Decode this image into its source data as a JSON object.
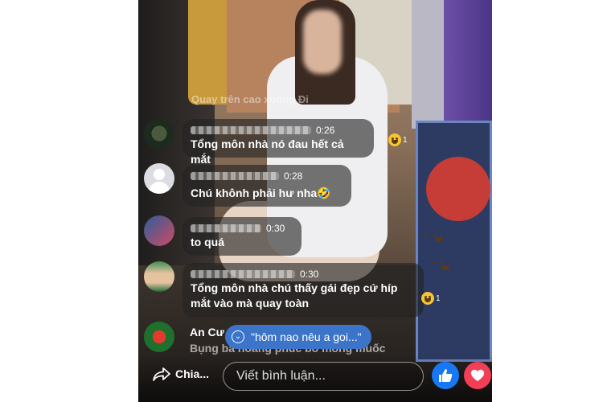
{
  "stream": {
    "dim_comment": "Quay trên cao xuống Đi"
  },
  "comments": [
    {
      "time": "0:26",
      "text": "Tổng môn nhà nó đau hết cả mắt",
      "reaction_count": "1"
    },
    {
      "time": "0:28",
      "text": "Chú khônh phải hư nha🤣"
    },
    {
      "time": "0:30",
      "text": "to quá"
    },
    {
      "time": "0:30",
      "text_line1": "Tổng môn nhà chú thấy gái đẹp cứ híp",
      "text_line2": "mắt vào mà quay toàn",
      "reaction_count": "1"
    },
    {
      "name": "An Cư",
      "text": "Bụng bà hoàng phúc bo mong muốc"
    }
  ],
  "new_comment_pill": "\"hôm nao nêu a goi...\"",
  "bottom_bar": {
    "share_label": "Chia...",
    "comment_placeholder": "Viết bình luận..."
  },
  "icons": {
    "like": "thumbs-up-icon",
    "love": "heart-icon",
    "share": "share-arrow-icon",
    "emoji": "laughing-emoji-icon"
  },
  "colors": {
    "like": "#1877f2",
    "love": "#f33e58",
    "pill": "#3b74c8"
  }
}
